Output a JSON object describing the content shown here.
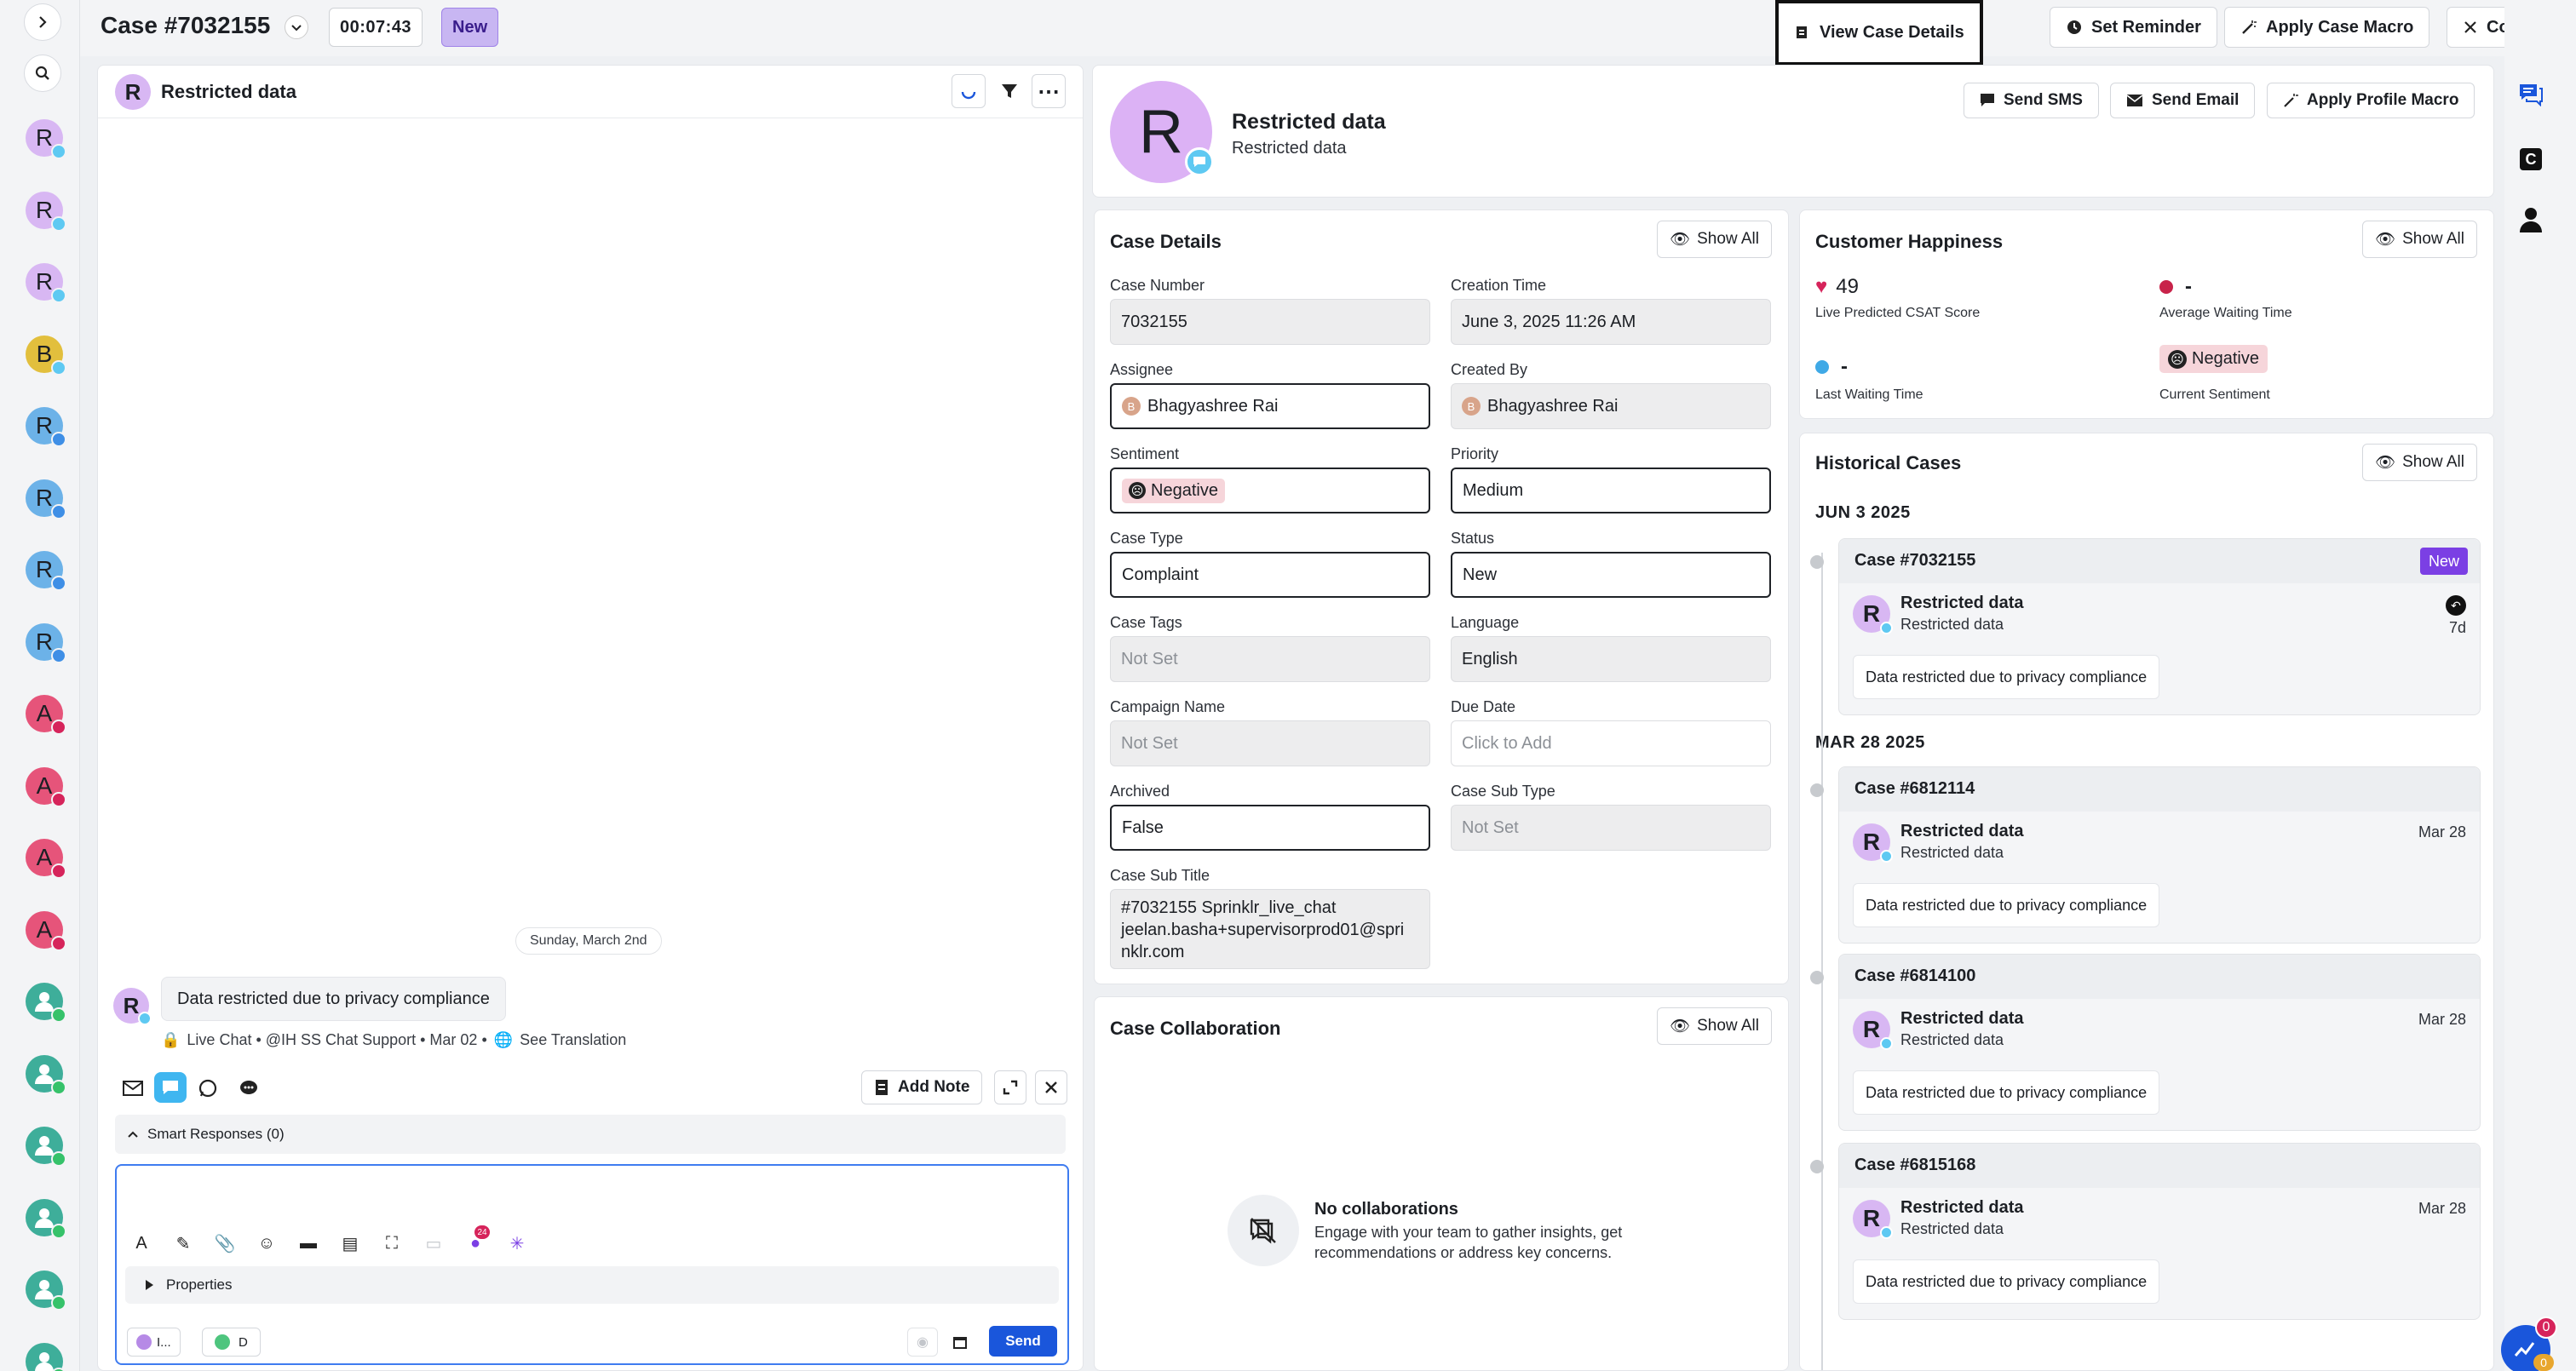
{
  "header": {
    "case_title": "Case #7032155",
    "timer": "00:07:43",
    "status_badge": "New",
    "view_case_details": "View Case Details",
    "set_reminder": "Set Reminder",
    "apply_case_macro": "Apply Case Macro",
    "collapse_case": "Collapse Case"
  },
  "rail": {
    "avatars": [
      "R",
      "R",
      "R",
      "B",
      "R",
      "R",
      "R",
      "R",
      "A",
      "A",
      "A",
      "A",
      "",
      "",
      "",
      "",
      "",
      ""
    ]
  },
  "conversation": {
    "title": "Restricted data",
    "avatar": "R",
    "date_separator": "Sunday, March 2nd",
    "message_avatar": "R",
    "message_text": "Data restricted due to privacy compliance",
    "message_meta": "Live Chat • @IH SS Chat Support • Mar 02 •",
    "see_translation": "See Translation",
    "add_note": "Add Note",
    "smart_responses": "Smart Responses (0)",
    "properties": "Properties",
    "chip1": "I...",
    "chip2": "D",
    "send": "Send",
    "badge_count": "24"
  },
  "profile": {
    "avatar": "R",
    "name": "Restricted data",
    "subtitle": "Restricted data",
    "send_sms": "Send SMS",
    "send_email": "Send Email",
    "apply_profile_macro": "Apply Profile Macro"
  },
  "case_details": {
    "title": "Case Details",
    "show_all": "Show All",
    "fields": {
      "case_number": {
        "label": "Case Number",
        "value": "7032155"
      },
      "creation_time": {
        "label": "Creation Time",
        "value": "June 3, 2025 11:26 AM"
      },
      "assignee": {
        "label": "Assignee",
        "value": "Bhagyashree Rai",
        "initial": "B"
      },
      "created_by": {
        "label": "Created By",
        "value": "Bhagyashree Rai",
        "initial": "B"
      },
      "sentiment": {
        "label": "Sentiment",
        "value": "Negative"
      },
      "priority": {
        "label": "Priority",
        "value": "Medium"
      },
      "case_type": {
        "label": "Case Type",
        "value": "Complaint"
      },
      "status": {
        "label": "Status",
        "value": "New"
      },
      "case_tags": {
        "label": "Case Tags",
        "value": "Not Set"
      },
      "language": {
        "label": "Language",
        "value": "English"
      },
      "campaign_name": {
        "label": "Campaign Name",
        "value": "Not Set"
      },
      "due_date": {
        "label": "Due Date",
        "value": "Click to Add"
      },
      "archived": {
        "label": "Archived",
        "value": "False"
      },
      "case_sub_type": {
        "label": "Case Sub Type",
        "value": "Not Set"
      },
      "case_sub_title": {
        "label": "Case Sub Title",
        "line1": "#7032155 Sprinklr_live_chat",
        "line2": "jeelan.basha+supervisorprod01@spri",
        "line3": "nklr.com"
      }
    }
  },
  "collaboration": {
    "title": "Case Collaboration",
    "show_all": "Show All",
    "empty_title": "No collaborations",
    "empty_line1": "Engage with your team to gather insights, get",
    "empty_line2": "recommendations or address key concerns."
  },
  "happiness": {
    "title": "Customer Happiness",
    "show_all": "Show All",
    "csat_value": "49",
    "csat_label": "Live Predicted CSAT Score",
    "avg_wait_value": "-",
    "avg_wait_label": "Average Waiting Time",
    "last_wait_value": "-",
    "last_wait_label": "Last Waiting Time",
    "sentiment_value": "Negative",
    "sentiment_label": "Current Sentiment"
  },
  "historical": {
    "title": "Historical Cases",
    "show_all": "Show All",
    "group1": "JUN 3 2025",
    "group2": "MAR 28 2025",
    "cases": [
      {
        "id": "Case #7032155",
        "badge": "New",
        "name": "Restricted data",
        "sub": "Restricted data",
        "date": "7d",
        "note": "Data restricted due to privacy compliance"
      },
      {
        "id": "Case #6812114",
        "name": "Restricted data",
        "sub": "Restricted data",
        "date": "Mar 28",
        "note": "Data restricted due to privacy compliance"
      },
      {
        "id": "Case #6814100",
        "name": "Restricted data",
        "sub": "Restricted data",
        "date": "Mar 28",
        "note": "Data restricted due to privacy compliance"
      },
      {
        "id": "Case #6815168",
        "name": "Restricted data",
        "sub": "Restricted data",
        "date": "Mar 28",
        "note": "Data restricted due to privacy compliance"
      }
    ]
  },
  "right_rail": {
    "c_label": "C",
    "badge_top": "0",
    "badge_bottom": "0"
  },
  "colors": {
    "accent_blue": "#1a56db",
    "purple_badge": "#7b3fe4",
    "new_chip": "#c8b6f2",
    "negative_chip": "#f6d5da",
    "heart": "#d6245b"
  }
}
